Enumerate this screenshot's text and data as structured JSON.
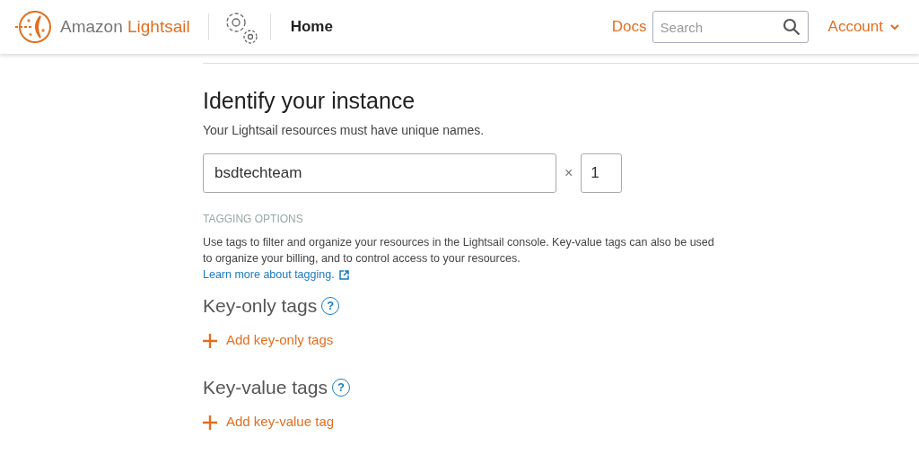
{
  "header": {
    "brand_prefix": "Amazon",
    "brand_name": "Lightsail",
    "page": "Home",
    "docs": "Docs",
    "search": {
      "placeholder": "Search"
    },
    "account": "Account"
  },
  "identify": {
    "title": "Identify your instance",
    "subtitle": "Your Lightsail resources must have unique names.",
    "name_value": "bsdtechteam",
    "times": "×",
    "count_value": "1"
  },
  "tagging": {
    "label": "TAGGING OPTIONS",
    "description": "Use tags to filter and organize your resources in the Lightsail console. Key-value tags can also be used to organize your billing, and to control access to your resources.",
    "link": "Learn more about tagging."
  },
  "tag_sections": [
    {
      "title": "Key-only tags",
      "help": "?",
      "add": "Add key-only tags"
    },
    {
      "title": "Key-value tags",
      "help": "?",
      "add": "Add key-value tag"
    }
  ]
}
